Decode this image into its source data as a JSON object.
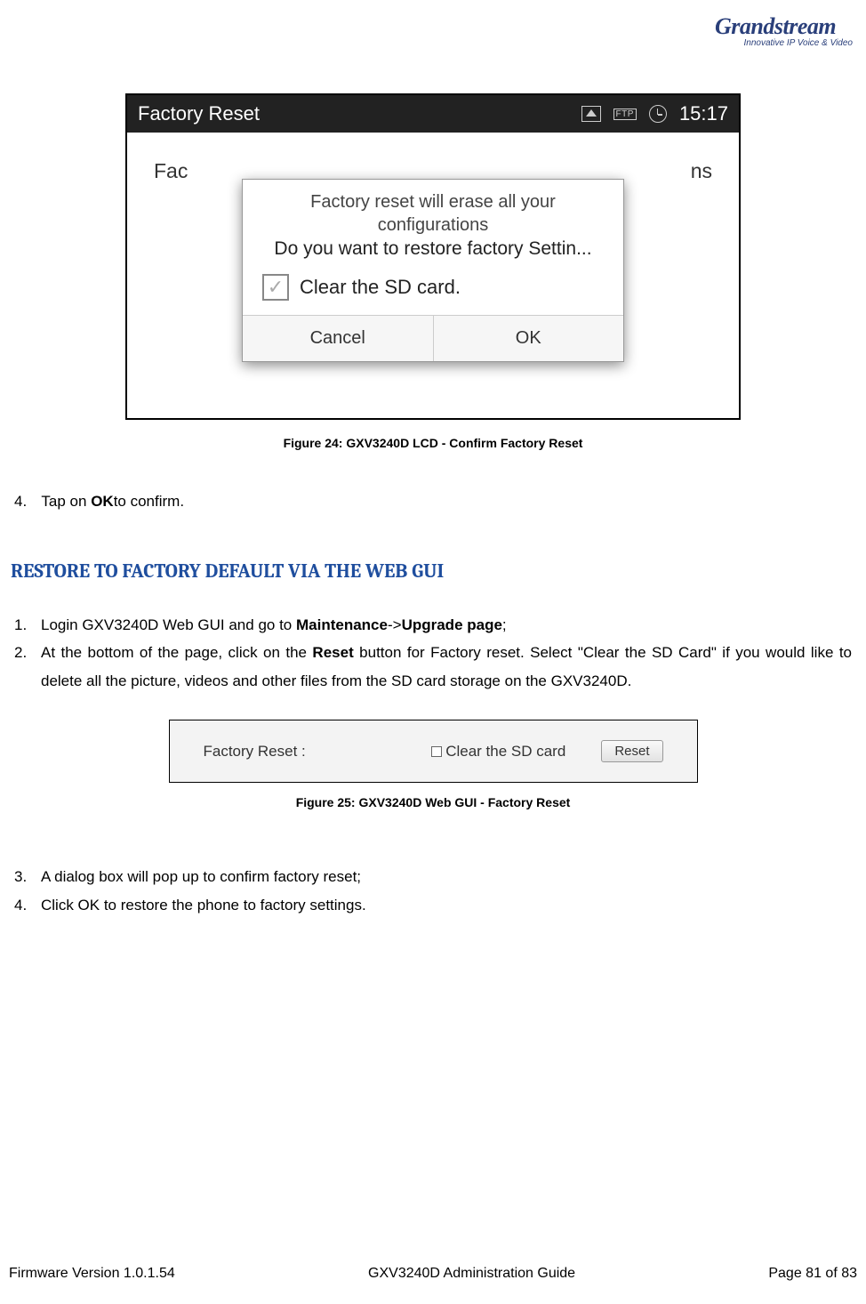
{
  "logo": {
    "main": "Grandstream",
    "sub": "Innovative IP Voice & Video"
  },
  "figure24": {
    "statusTitle": "Factory Reset",
    "ftp": "FTP",
    "time": "15:17",
    "bgLeft": "Fac",
    "bgRight": "ns",
    "dialogTitle": "Factory reset will erase all your configurations",
    "dialogSub": "Do you want to restore factory Settin...",
    "checkLabel": "Clear the SD card.",
    "cancel": "Cancel",
    "ok": "OK",
    "caption": "Figure 24: GXV3240D LCD - Confirm Factory Reset"
  },
  "step4": {
    "num": "4.",
    "pre": "Tap on ",
    "bold": "OK",
    "post": "to confirm."
  },
  "h2": "RESTORE TO FACTORY DEFAULT VIA THE WEB GUI",
  "list1": {
    "i1": {
      "num": "1.",
      "a": "Login GXV3240D Web GUI and go to ",
      "b": "Maintenance",
      "c": "->",
      "d": "Upgrade page",
      "e": ";"
    },
    "i2": {
      "num": "2.",
      "a": "At the bottom of the page, click on the ",
      "b": "Reset",
      "c": " button for Factory reset. Select \"Clear the SD Card\" if you would like to delete all the picture, videos and other files from the SD card storage on the GXV3240D."
    }
  },
  "figure25": {
    "label": "Factory Reset :",
    "check": "Clear the SD card",
    "btn": "Reset",
    "caption": "Figure 25: GXV3240D Web GUI - Factory Reset"
  },
  "list2": {
    "i3": {
      "num": "3.",
      "t": "A dialog box will pop up to confirm factory reset;"
    },
    "i4": {
      "num": "4.",
      "t": "Click OK to restore the phone to factory settings."
    }
  },
  "footer": {
    "left": "Firmware Version 1.0.1.54",
    "center": "GXV3240D Administration Guide",
    "right": "Page 81 of 83"
  }
}
